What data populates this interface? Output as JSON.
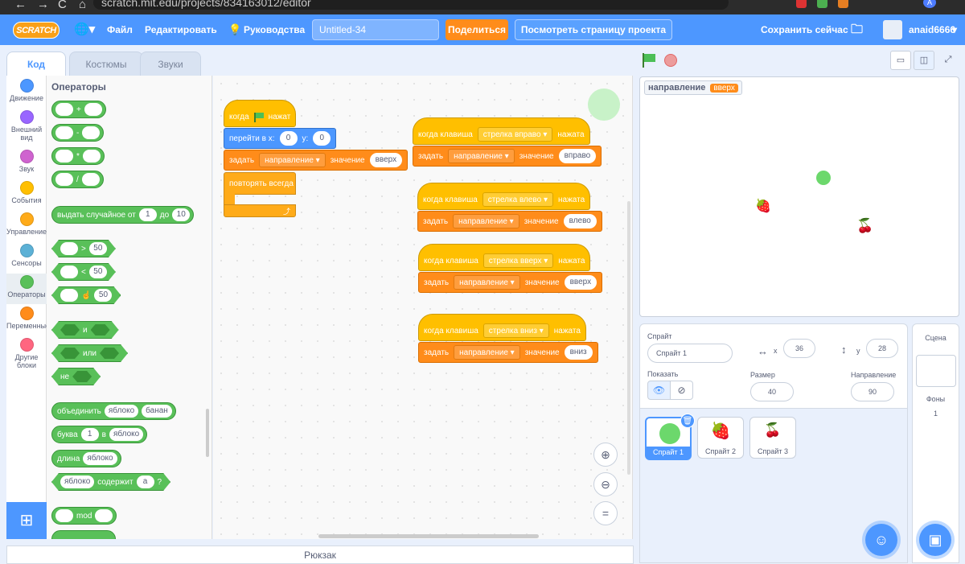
{
  "browser": {
    "url": "scratch.mit.edu/projects/834163012/editor",
    "profile_initial": "А"
  },
  "menubar": {
    "logo": "SCRATCH",
    "file": "Файл",
    "edit": "Редактировать",
    "tutorials": "Руководства",
    "project_title": "Untitled-34",
    "share": "Поделиться",
    "see_project_page": "Посмотреть страницу проекта",
    "save_now": "Сохранить сейчас",
    "username": "anaid6666"
  },
  "tabs": {
    "code": "Код",
    "costumes": "Костюмы",
    "sounds": "Звуки"
  },
  "categories": [
    {
      "label": "Движение",
      "color": "#4c97ff"
    },
    {
      "label": "Внешний вид",
      "color": "#9966ff"
    },
    {
      "label": "Звук",
      "color": "#cf63cf"
    },
    {
      "label": "События",
      "color": "#ffbf00"
    },
    {
      "label": "Управление",
      "color": "#ffab19"
    },
    {
      "label": "Сенсоры",
      "color": "#5cb1d6"
    },
    {
      "label": "Операторы",
      "color": "#59c059"
    },
    {
      "label": "Переменные",
      "color": "#ff8c1a"
    },
    {
      "label": "Другие блоки",
      "color": "#ff6680"
    }
  ],
  "palette": {
    "title": "Операторы",
    "add": "+",
    "sub": "-",
    "mul": "*",
    "div": "/",
    "random": {
      "text1": "выдать случайное от",
      "from": "1",
      "text2": "до",
      "to": "10"
    },
    "gt": {
      "op": ">",
      "val": "50"
    },
    "lt": {
      "op": "<",
      "val": "50"
    },
    "eq": {
      "val": "50"
    },
    "and": "и",
    "or": "или",
    "not": "не",
    "join": {
      "label": "объединить",
      "a": "яблоко",
      "b": "банан"
    },
    "letter": {
      "label": "буква",
      "n": "1",
      "in": "в",
      "s": "яблоко"
    },
    "length": {
      "label": "длина",
      "s": "яблоко"
    },
    "contains": {
      "s": "яблоко",
      "label": "содержит",
      "a": "а",
      "q": "?"
    },
    "mod": "mod"
  },
  "scripts": {
    "flag_script": {
      "when_flag": "когда",
      "clicked": "нажат",
      "goto": "перейти в x:",
      "x": "0",
      "y_label": "y:",
      "y": "0",
      "set": "задать",
      "var": "направление",
      "to": "значение",
      "value": "вверх",
      "forever": "повторять всегда"
    },
    "key_scripts": [
      {
        "when": "когда клавиша",
        "key": "стрелка вправо",
        "pressed": "нажата",
        "set": "задать",
        "var": "направление",
        "to": "значение",
        "value": "вправо"
      },
      {
        "when": "когда клавиша",
        "key": "стрелка влево",
        "pressed": "нажата",
        "set": "задать",
        "var": "направление",
        "to": "значение",
        "value": "влево"
      },
      {
        "when": "когда клавиша",
        "key": "стрелка вверх",
        "pressed": "нажата",
        "set": "задать",
        "var": "направление",
        "to": "значение",
        "value": "вверх"
      },
      {
        "when": "когда клавиша",
        "key": "стрелка вниз",
        "pressed": "нажата",
        "set": "задать",
        "var": "направление",
        "to": "значение",
        "value": "вниз"
      }
    ]
  },
  "backpack": "Рюкзак",
  "stage": {
    "monitor_label": "направление",
    "monitor_value": "вверх"
  },
  "sprite_info": {
    "sprite_label": "Спрайт",
    "sprite_name": "Спрайт 1",
    "x_label": "x",
    "x": "36",
    "y_label": "y",
    "y": "28",
    "show_label": "Показать",
    "size_label": "Размер",
    "size": "40",
    "direction_label": "Направление",
    "direction": "90"
  },
  "sprites": [
    {
      "name": "Спрайт 1"
    },
    {
      "name": "Спрайт 2"
    },
    {
      "name": "Спрайт 3"
    }
  ],
  "stage_panel": {
    "title": "Сцена",
    "backdrops_label": "Фоны",
    "backdrops_count": "1"
  }
}
